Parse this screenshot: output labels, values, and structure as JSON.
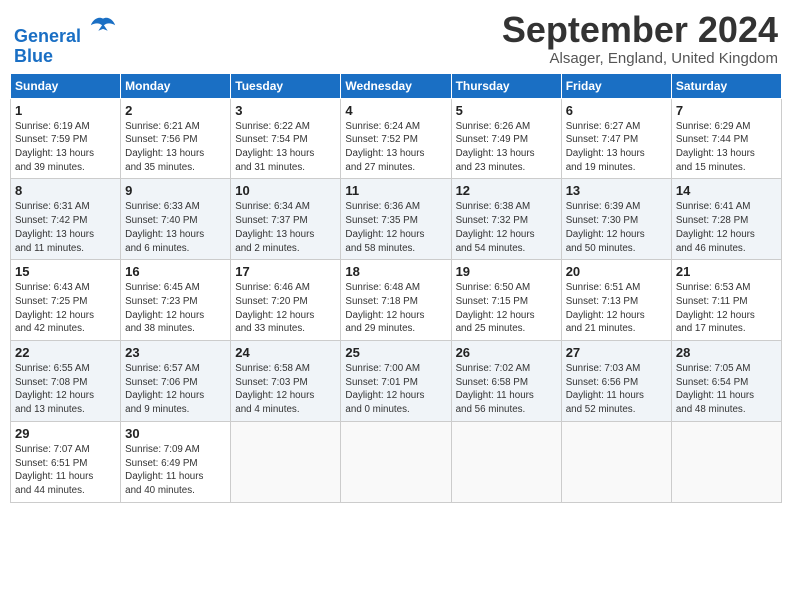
{
  "header": {
    "logo_line1": "General",
    "logo_line2": "Blue",
    "month_title": "September 2024",
    "location": "Alsager, England, United Kingdom"
  },
  "weekdays": [
    "Sunday",
    "Monday",
    "Tuesday",
    "Wednesday",
    "Thursday",
    "Friday",
    "Saturday"
  ],
  "weeks": [
    [
      {
        "day": "1",
        "info": "Sunrise: 6:19 AM\nSunset: 7:59 PM\nDaylight: 13 hours\nand 39 minutes."
      },
      {
        "day": "2",
        "info": "Sunrise: 6:21 AM\nSunset: 7:56 PM\nDaylight: 13 hours\nand 35 minutes."
      },
      {
        "day": "3",
        "info": "Sunrise: 6:22 AM\nSunset: 7:54 PM\nDaylight: 13 hours\nand 31 minutes."
      },
      {
        "day": "4",
        "info": "Sunrise: 6:24 AM\nSunset: 7:52 PM\nDaylight: 13 hours\nand 27 minutes."
      },
      {
        "day": "5",
        "info": "Sunrise: 6:26 AM\nSunset: 7:49 PM\nDaylight: 13 hours\nand 23 minutes."
      },
      {
        "day": "6",
        "info": "Sunrise: 6:27 AM\nSunset: 7:47 PM\nDaylight: 13 hours\nand 19 minutes."
      },
      {
        "day": "7",
        "info": "Sunrise: 6:29 AM\nSunset: 7:44 PM\nDaylight: 13 hours\nand 15 minutes."
      }
    ],
    [
      {
        "day": "8",
        "info": "Sunrise: 6:31 AM\nSunset: 7:42 PM\nDaylight: 13 hours\nand 11 minutes."
      },
      {
        "day": "9",
        "info": "Sunrise: 6:33 AM\nSunset: 7:40 PM\nDaylight: 13 hours\nand 6 minutes."
      },
      {
        "day": "10",
        "info": "Sunrise: 6:34 AM\nSunset: 7:37 PM\nDaylight: 13 hours\nand 2 minutes."
      },
      {
        "day": "11",
        "info": "Sunrise: 6:36 AM\nSunset: 7:35 PM\nDaylight: 12 hours\nand 58 minutes."
      },
      {
        "day": "12",
        "info": "Sunrise: 6:38 AM\nSunset: 7:32 PM\nDaylight: 12 hours\nand 54 minutes."
      },
      {
        "day": "13",
        "info": "Sunrise: 6:39 AM\nSunset: 7:30 PM\nDaylight: 12 hours\nand 50 minutes."
      },
      {
        "day": "14",
        "info": "Sunrise: 6:41 AM\nSunset: 7:28 PM\nDaylight: 12 hours\nand 46 minutes."
      }
    ],
    [
      {
        "day": "15",
        "info": "Sunrise: 6:43 AM\nSunset: 7:25 PM\nDaylight: 12 hours\nand 42 minutes."
      },
      {
        "day": "16",
        "info": "Sunrise: 6:45 AM\nSunset: 7:23 PM\nDaylight: 12 hours\nand 38 minutes."
      },
      {
        "day": "17",
        "info": "Sunrise: 6:46 AM\nSunset: 7:20 PM\nDaylight: 12 hours\nand 33 minutes."
      },
      {
        "day": "18",
        "info": "Sunrise: 6:48 AM\nSunset: 7:18 PM\nDaylight: 12 hours\nand 29 minutes."
      },
      {
        "day": "19",
        "info": "Sunrise: 6:50 AM\nSunset: 7:15 PM\nDaylight: 12 hours\nand 25 minutes."
      },
      {
        "day": "20",
        "info": "Sunrise: 6:51 AM\nSunset: 7:13 PM\nDaylight: 12 hours\nand 21 minutes."
      },
      {
        "day": "21",
        "info": "Sunrise: 6:53 AM\nSunset: 7:11 PM\nDaylight: 12 hours\nand 17 minutes."
      }
    ],
    [
      {
        "day": "22",
        "info": "Sunrise: 6:55 AM\nSunset: 7:08 PM\nDaylight: 12 hours\nand 13 minutes."
      },
      {
        "day": "23",
        "info": "Sunrise: 6:57 AM\nSunset: 7:06 PM\nDaylight: 12 hours\nand 9 minutes."
      },
      {
        "day": "24",
        "info": "Sunrise: 6:58 AM\nSunset: 7:03 PM\nDaylight: 12 hours\nand 4 minutes."
      },
      {
        "day": "25",
        "info": "Sunrise: 7:00 AM\nSunset: 7:01 PM\nDaylight: 12 hours\nand 0 minutes."
      },
      {
        "day": "26",
        "info": "Sunrise: 7:02 AM\nSunset: 6:58 PM\nDaylight: 11 hours\nand 56 minutes."
      },
      {
        "day": "27",
        "info": "Sunrise: 7:03 AM\nSunset: 6:56 PM\nDaylight: 11 hours\nand 52 minutes."
      },
      {
        "day": "28",
        "info": "Sunrise: 7:05 AM\nSunset: 6:54 PM\nDaylight: 11 hours\nand 48 minutes."
      }
    ],
    [
      {
        "day": "29",
        "info": "Sunrise: 7:07 AM\nSunset: 6:51 PM\nDaylight: 11 hours\nand 44 minutes."
      },
      {
        "day": "30",
        "info": "Sunrise: 7:09 AM\nSunset: 6:49 PM\nDaylight: 11 hours\nand 40 minutes."
      },
      {
        "day": "",
        "info": ""
      },
      {
        "day": "",
        "info": ""
      },
      {
        "day": "",
        "info": ""
      },
      {
        "day": "",
        "info": ""
      },
      {
        "day": "",
        "info": ""
      }
    ]
  ]
}
